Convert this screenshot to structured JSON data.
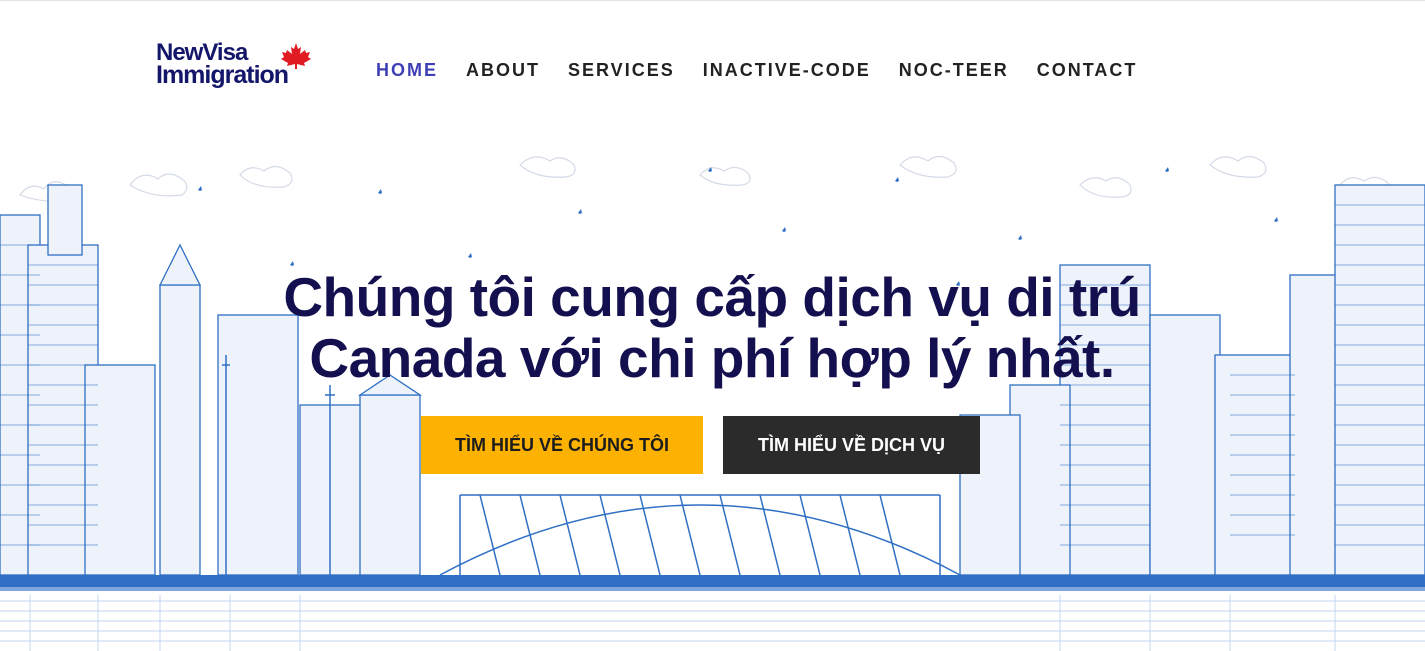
{
  "brand": {
    "line1": "NewVisa",
    "line2": "Immigration",
    "leaf_icon": "maple-leaf-icon",
    "primary_color": "#14166a",
    "leaf_color": "#e11b22"
  },
  "nav": {
    "items": [
      {
        "label": "HOME",
        "active": true
      },
      {
        "label": "ABOUT",
        "active": false
      },
      {
        "label": "SERVICES",
        "active": false
      },
      {
        "label": "INACTIVE-CODE",
        "active": false
      },
      {
        "label": "NOC-TEER",
        "active": false
      },
      {
        "label": "CONTACT",
        "active": false
      }
    ],
    "active_color": "#3f3fb5"
  },
  "hero": {
    "headline_line1": "Chúng tôi cung cấp dịch vụ di trú",
    "headline_line2": "Canada với chi phí hợp lý nhất.",
    "buttons": {
      "about_label": "TÌM HIỂU VỀ CHÚNG TÔI",
      "services_label": "TÌM HIỂU VỀ DỊCH VỤ"
    },
    "colors": {
      "headline": "#14104f",
      "about_button": "#fdb100",
      "services_button": "#2b2b2b",
      "skyline": "#2f6fc4"
    }
  }
}
